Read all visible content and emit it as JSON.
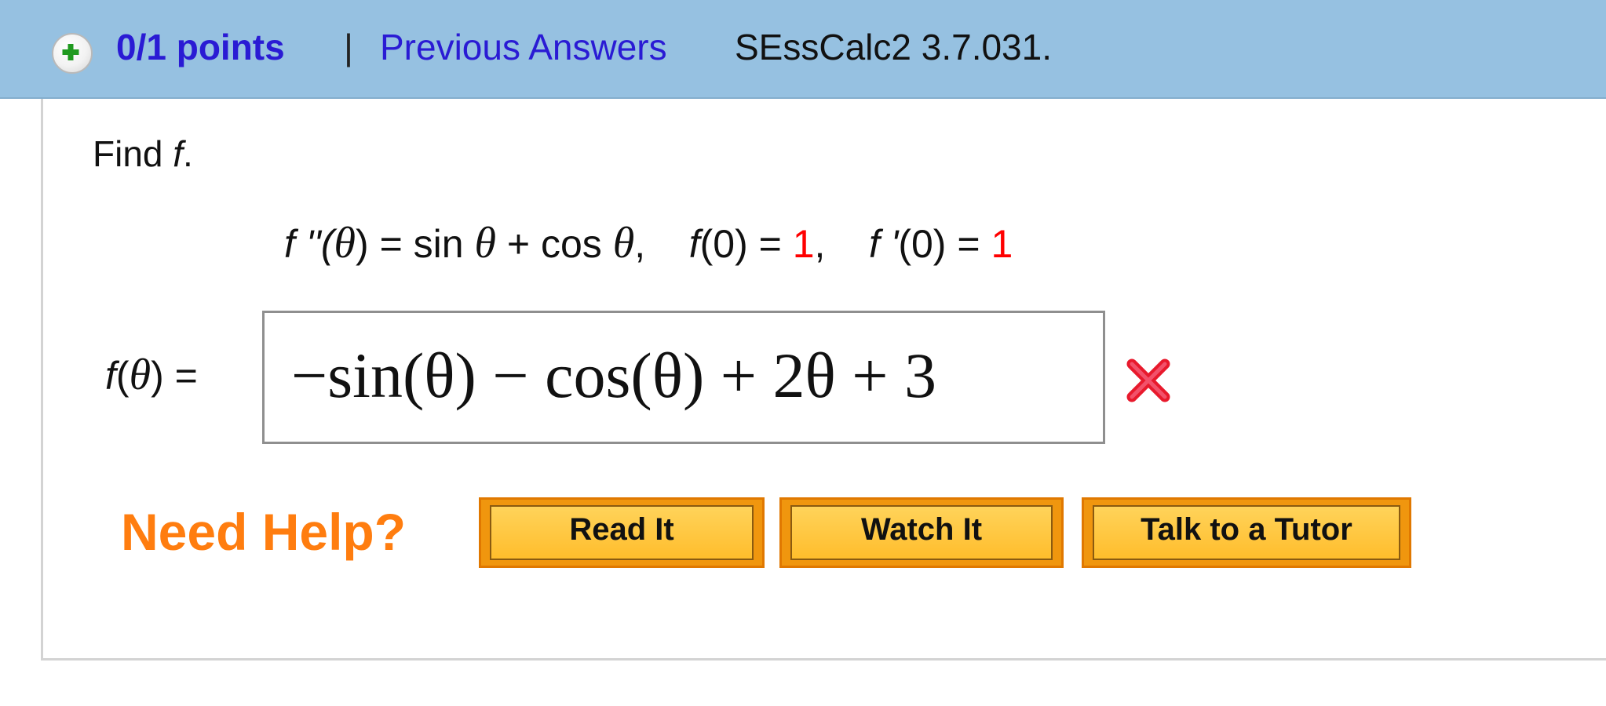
{
  "header": {
    "points": "0/1 points",
    "separator": "|",
    "previous_answers": "Previous Answers",
    "problem_id": "SEssCalc2 3.7.031."
  },
  "question": {
    "prompt_text": "Find",
    "prompt_var": "f",
    "prompt_end": ".",
    "given": {
      "fpp": "f ''(",
      "theta": "θ",
      "eq_part": ") = sin ",
      "plus_cos": " + cos ",
      "comma": ",",
      "f0_label": "f",
      "f0_eq": "(0) = ",
      "f0_value": "1",
      "fp0_label": "f '",
      "fp0_eq": "(0) = ",
      "fp0_value": "1"
    },
    "answer_label_f": "f",
    "answer_label_rest": ") =",
    "answer_value": "−sin(θ) − cos(θ) + 2θ + 3",
    "result": "incorrect"
  },
  "help": {
    "label": "Need Help?",
    "buttons": [
      "Read It",
      "Watch It",
      "Talk to a Tutor"
    ]
  },
  "colors": {
    "header_bg": "#96c1e1",
    "link": "#2a1bd4",
    "help_orange": "#ff7d0f",
    "button_bg": "#ffbd2c",
    "wrong": "#e8192c"
  },
  "icons": {
    "expand": "plus-circle-icon",
    "result": "x-mark-icon"
  }
}
